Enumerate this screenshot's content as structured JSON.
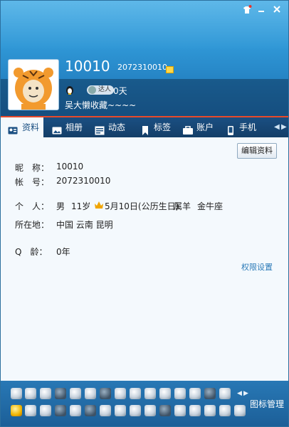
{
  "profile": {
    "nickname": "10010",
    "qq_number": "2072310010",
    "daren_label": "达人",
    "days": "0天",
    "signature": "吴大懒收藏~~~~"
  },
  "tabs": [
    {
      "label": "资料",
      "icon": "id-card-icon",
      "active": true
    },
    {
      "label": "相册",
      "icon": "photo-album-icon"
    },
    {
      "label": "动态",
      "icon": "feed-icon"
    },
    {
      "label": "标签",
      "icon": "bookmark-icon"
    },
    {
      "label": "账户",
      "icon": "wallet-icon"
    },
    {
      "label": "手机",
      "icon": "phone-icon"
    }
  ],
  "content": {
    "edit_button": "编辑资料",
    "nickname_label": "昵　称：",
    "nickname_value": "10010",
    "account_label": "帐　号：",
    "account_value": "2072310010",
    "personal_label": "个　人：",
    "personal_gender": "男",
    "personal_age": "11岁",
    "personal_birthday": "5月10日(公历生日)",
    "personal_zodiac": "属羊",
    "personal_constellation": "金牛座",
    "location_label": "所在地：",
    "location_value": "中国 云南 昆明",
    "qage_label": "Q　龄：",
    "qage_value": "0年",
    "permission_link": "权限设置"
  },
  "footer": {
    "manage_label": "图标管理"
  },
  "colors": {
    "header_blue": "#2f97d6",
    "tab_bar": "#1a4f82",
    "accent_red": "#e84a2a",
    "link_blue": "#2a7ab8",
    "footer_blue": "#2878b5"
  }
}
